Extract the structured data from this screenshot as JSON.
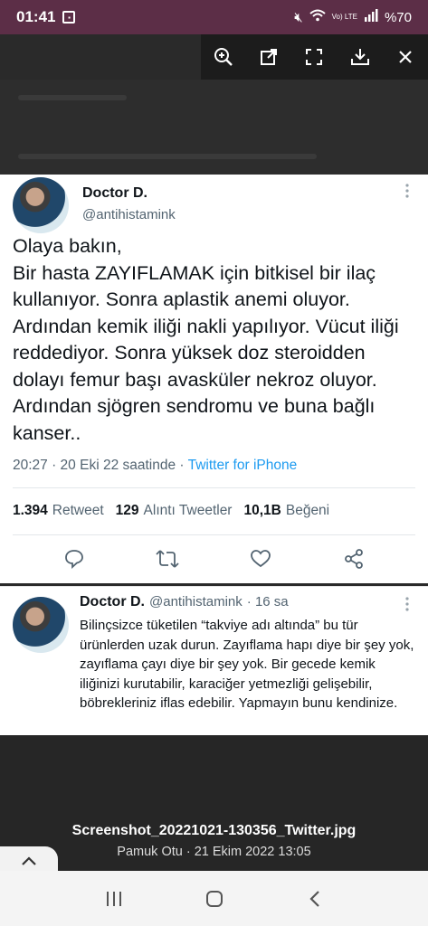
{
  "status_bar": {
    "time": "01:41",
    "battery": "%70",
    "network": "Vo) LTE"
  },
  "main_tweet": {
    "name": "Doctor D.",
    "handle": "@antihistamink",
    "text": "Olaya bakın,\nBir hasta ZAYIFLAMAK için bitkisel bir ilaç kullanıyor. Sonra aplastik anemi oluyor. Ardından kemik iliği nakli yapılıyor. Vücut iliği reddediyor. Sonra yüksek doz steroidden dolayı femur başı avasküler nekroz oluyor. Ardından sjögren sendromu ve buna bağlı kanser..",
    "timestamp": "20:27 · 20 Eki 22 saatinde · ",
    "client": "Twitter for iPhone",
    "stats": {
      "retweets_count": "1.394",
      "retweets_label": "Retweet",
      "quotes_count": "129",
      "quotes_label": "Alıntı Tweetler",
      "likes_count": "10,1B",
      "likes_label": "Beğeni"
    }
  },
  "reply_tweet": {
    "name": "Doctor D.",
    "handle": "@antihistamink",
    "time": "· 16 sa",
    "text": "Bilinçsizce tüketilen “takviye adı altında” bu tür ürünlerden uzak durun. Zayıflama hapı diye bir şey yok, zayıflama çayı diye bir şey yok. Bir gecede kemik iliğinizi kurutabilir, karaciğer yetmezliği gelişebilir, böbrekleriniz iflas edebilir. Yapmayın bunu kendinize."
  },
  "file_info": {
    "name": "Screenshot_20221021-130356_Twitter.jpg",
    "subtitle": "Pamuk Otu · 21 Ekim 2022 13:05"
  },
  "colors": {
    "status_bar_bg": "#5c2e47",
    "link_blue": "#1d9bf0",
    "secondary_text": "#536471"
  },
  "icons": [
    "zoom-in-icon",
    "open-external-icon",
    "fullscreen-icon",
    "download-icon",
    "close-icon",
    "reply-icon",
    "retweet-icon",
    "like-icon",
    "share-icon",
    "chevron-up-icon",
    "recents-icon",
    "home-icon",
    "back-icon"
  ]
}
